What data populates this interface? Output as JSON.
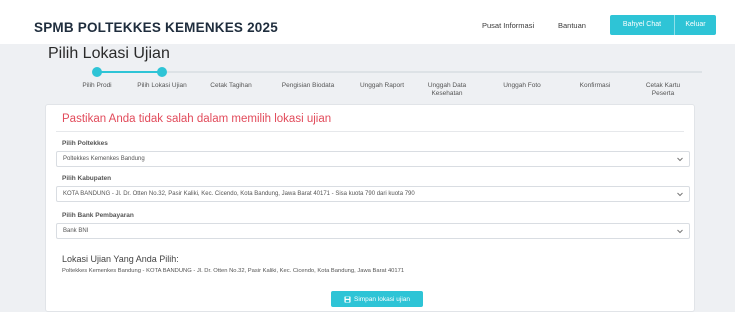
{
  "header": {
    "brand": "SPMB POLTEKKES KEMENKES 2025",
    "nav": {
      "info": "Pusat Informasi",
      "help": "Bantuan"
    },
    "buttons": {
      "chat": "Bahyel Chat",
      "exit": "Keluar"
    }
  },
  "page": {
    "title": "Pilih Lokasi Ujian"
  },
  "stepper": {
    "steps": [
      {
        "label": "Pilih Prodi",
        "done": true
      },
      {
        "label": "Pilih Lokasi Ujian",
        "done": true
      },
      {
        "label": "Cetak Tagihan",
        "done": false
      },
      {
        "label": "Pengisian Biodata",
        "done": false
      },
      {
        "label": "Unggah Raport",
        "done": false
      },
      {
        "label": "Unggah Data\nKesehatan",
        "done": false
      },
      {
        "label": "Unggah Foto",
        "done": false
      },
      {
        "label": "Konfirmasi",
        "done": false
      },
      {
        "label": "Cetak Kartu\nPeserta",
        "done": false
      }
    ]
  },
  "form": {
    "warning": "Pastikan Anda tidak salah dalam memilih lokasi ujian",
    "poltekkes": {
      "label": "Pilih Poltekkes",
      "value": "Poltekkes Kemenkes Bandung"
    },
    "kabupaten": {
      "label": "Pilih Kabupaten",
      "value": "KOTA BANDUNG - Jl. Dr. Otten No.32, Pasir Kaliki, Kec. Cicendo, Kota Bandung, Jawa Barat 40171 - Sisa kuota 790 dari kuota 790"
    },
    "bank": {
      "label": "Pilih Bank Pembayaran",
      "value": "Bank BNI"
    }
  },
  "selected": {
    "title": "Lokasi Ujian Yang Anda Pilih:",
    "text": "Poltekkes Kemenkes Bandung - KOTA BANDUNG - Jl. Dr. Otten No.32, Pasir Kaliki, Kec. Cicendo, Kota Bandung, Jawa Barat 40171"
  },
  "save_button": "Simpan lokasi ujian",
  "colors": {
    "accent": "#2ec4d6",
    "warning": "#e24b5b"
  }
}
